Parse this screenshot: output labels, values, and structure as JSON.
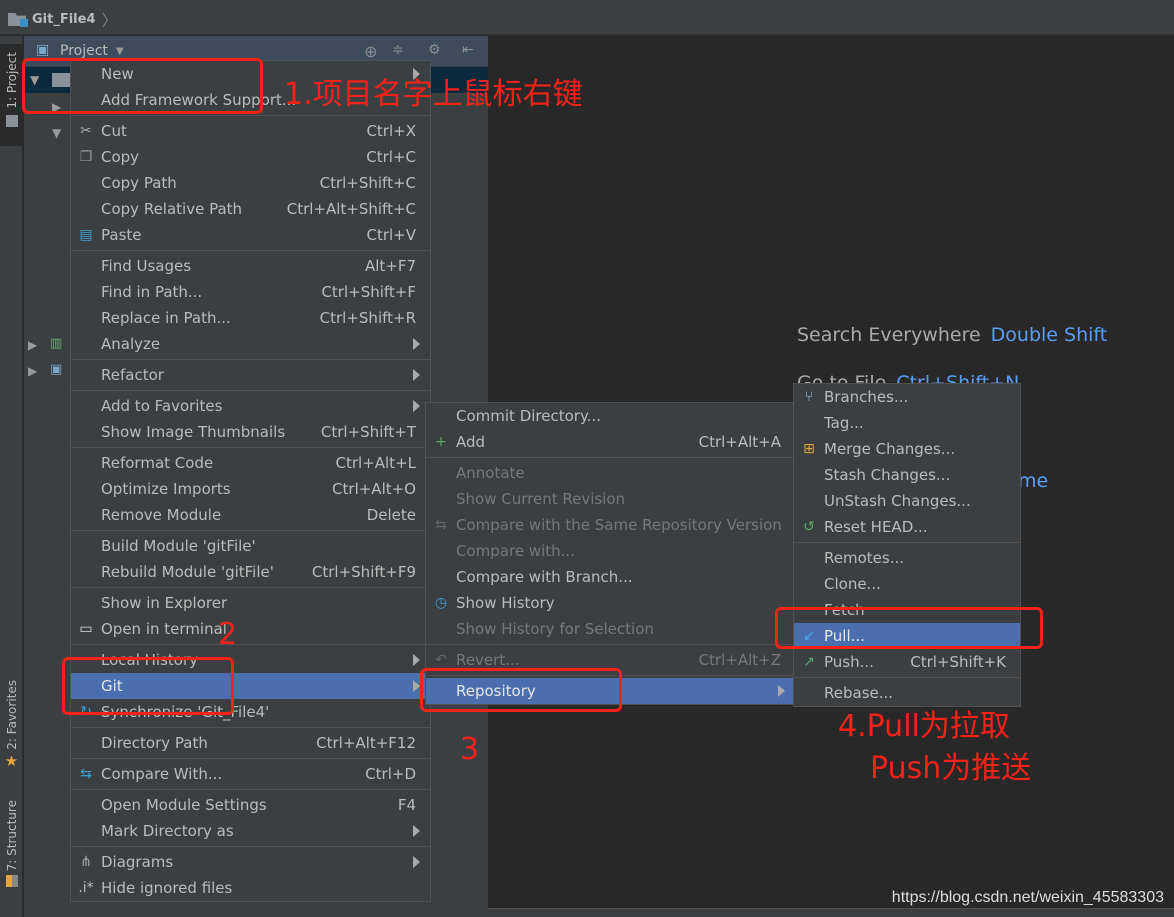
{
  "titlebar": {
    "breadcrumb": "Git_File4"
  },
  "stripe": {
    "tabs": [
      {
        "label": "1: Project"
      },
      {
        "label": "2: Favorites"
      },
      {
        "label": "7: Structure"
      }
    ]
  },
  "project_panel": {
    "title": "Project"
  },
  "editor_hints": {
    "search_everywhere": {
      "label": "Search Everywhere",
      "key": "Double Shift"
    },
    "goto_file": {
      "label": "Go to File",
      "key": "Ctrl+Shift+N"
    },
    "partial_key": "me"
  },
  "context_menu": {
    "items": [
      {
        "label": "New",
        "shortcut": "",
        "submenu": true
      },
      {
        "label": "Add Framework Support...",
        "shortcut": ""
      },
      {
        "sep": true
      },
      {
        "label": "Cut",
        "shortcut": "Ctrl+X",
        "icon": "scissors-icon"
      },
      {
        "label": "Copy",
        "shortcut": "Ctrl+C",
        "icon": "copy-icon"
      },
      {
        "label": "Copy Path",
        "shortcut": "Ctrl+Shift+C"
      },
      {
        "label": "Copy Relative Path",
        "shortcut": "Ctrl+Alt+Shift+C"
      },
      {
        "label": "Paste",
        "shortcut": "Ctrl+V",
        "icon": "paste-icon"
      },
      {
        "sep": true
      },
      {
        "label": "Find Usages",
        "shortcut": "Alt+F7"
      },
      {
        "label": "Find in Path...",
        "shortcut": "Ctrl+Shift+F"
      },
      {
        "label": "Replace in Path...",
        "shortcut": "Ctrl+Shift+R"
      },
      {
        "label": "Analyze",
        "shortcut": "",
        "submenu": true
      },
      {
        "sep": true
      },
      {
        "label": "Refactor",
        "shortcut": "",
        "submenu": true
      },
      {
        "sep": true
      },
      {
        "label": "Add to Favorites",
        "shortcut": "",
        "submenu": true
      },
      {
        "label": "Show Image Thumbnails",
        "shortcut": "Ctrl+Shift+T"
      },
      {
        "sep": true
      },
      {
        "label": "Reformat Code",
        "shortcut": "Ctrl+Alt+L"
      },
      {
        "label": "Optimize Imports",
        "shortcut": "Ctrl+Alt+O"
      },
      {
        "label": "Remove Module",
        "shortcut": "Delete"
      },
      {
        "sep": true
      },
      {
        "label": "Build Module 'gitFile'",
        "shortcut": ""
      },
      {
        "label": "Rebuild Module 'gitFile'",
        "shortcut": "Ctrl+Shift+F9"
      },
      {
        "sep": true
      },
      {
        "label": "Show in Explorer",
        "shortcut": ""
      },
      {
        "label": "Open in terminal",
        "shortcut": "",
        "icon": "terminal-icon"
      },
      {
        "sep": true
      },
      {
        "label": "Local History",
        "shortcut": "",
        "submenu": true
      },
      {
        "label": "Git",
        "shortcut": "",
        "submenu": true,
        "highlighted": true
      },
      {
        "label": "Synchronize 'Git_File4'",
        "shortcut": "",
        "icon": "sync-icon"
      },
      {
        "sep": true
      },
      {
        "label": "Directory Path",
        "shortcut": "Ctrl+Alt+F12"
      },
      {
        "sep": true
      },
      {
        "label": "Compare With...",
        "shortcut": "Ctrl+D",
        "icon": "compare-icon"
      },
      {
        "sep": true
      },
      {
        "label": "Open Module Settings",
        "shortcut": "F4"
      },
      {
        "label": "Mark Directory as",
        "shortcut": "",
        "submenu": true
      },
      {
        "sep": true
      },
      {
        "label": "Diagrams",
        "shortcut": "",
        "submenu": true,
        "icon": "diagram-icon"
      },
      {
        "label": "Hide ignored files",
        "shortcut": "",
        "icon": "ignored-files-icon"
      }
    ]
  },
  "git_menu": {
    "items": [
      {
        "label": "Commit Directory...",
        "shortcut": ""
      },
      {
        "label": "Add",
        "shortcut": "Ctrl+Alt+A",
        "icon": "plus-icon"
      },
      {
        "sep": true
      },
      {
        "label": "Annotate",
        "shortcut": "",
        "disabled": true
      },
      {
        "label": "Show Current Revision",
        "shortcut": "",
        "disabled": true
      },
      {
        "label": "Compare with the Same Repository Version",
        "shortcut": "",
        "disabled": true,
        "icon": "compare-icon"
      },
      {
        "label": "Compare with...",
        "shortcut": "",
        "disabled": true
      },
      {
        "label": "Compare with Branch...",
        "shortcut": ""
      },
      {
        "label": "Show History",
        "shortcut": "",
        "icon": "history-icon"
      },
      {
        "label": "Show History for Selection",
        "shortcut": "",
        "disabled": true
      },
      {
        "sep": true
      },
      {
        "label": "Revert...",
        "shortcut": "Ctrl+Alt+Z",
        "disabled": true,
        "icon": "revert-icon"
      },
      {
        "sep": true
      },
      {
        "label": "Repository",
        "shortcut": "",
        "submenu": true,
        "highlighted": true
      }
    ]
  },
  "repository_menu": {
    "items": [
      {
        "label": "Branches...",
        "shortcut": "",
        "icon": "branch-icon"
      },
      {
        "label": "Tag...",
        "shortcut": ""
      },
      {
        "label": "Merge Changes...",
        "shortcut": "",
        "icon": "merge-icon"
      },
      {
        "label": "Stash Changes...",
        "shortcut": ""
      },
      {
        "label": "UnStash Changes...",
        "shortcut": ""
      },
      {
        "label": "Reset HEAD...",
        "shortcut": "",
        "icon": "reset-icon"
      },
      {
        "sep": true
      },
      {
        "label": "Remotes...",
        "shortcut": ""
      },
      {
        "label": "Clone...",
        "shortcut": ""
      },
      {
        "label": "Fetch",
        "shortcut": ""
      },
      {
        "label": "Pull...",
        "shortcut": "",
        "icon": "pull-icon",
        "highlighted": true
      },
      {
        "label": "Push...",
        "shortcut": "Ctrl+Shift+K",
        "icon": "push-icon"
      },
      {
        "sep": true
      },
      {
        "label": "Rebase...",
        "shortcut": ""
      }
    ]
  },
  "annotations": {
    "step1": "1.项目名字上鼠标右键",
    "step2": "2",
    "step3": "3",
    "step4_line1": "4.Pull为拉取",
    "step4_line2": "Push为推送"
  },
  "watermark": "https://blog.csdn.net/weixin_45583303",
  "colors": {
    "highlight": "#4b6eaf",
    "annotation": "#f5221a",
    "key_hint": "#589df6",
    "menu_bg": "#3c3f41"
  }
}
